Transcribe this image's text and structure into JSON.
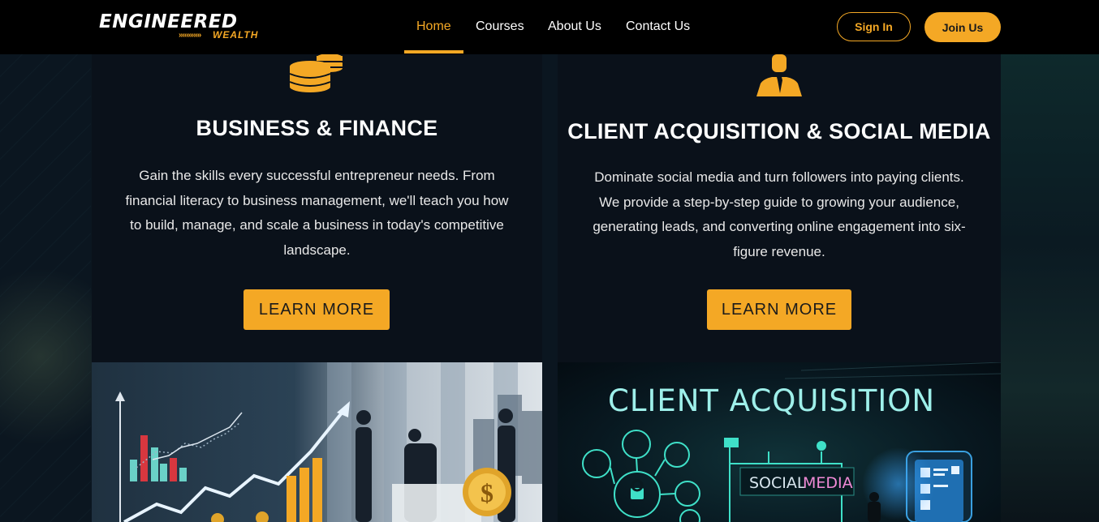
{
  "header": {
    "logo": {
      "main": "ENGINEERED",
      "sub": "WEALTH",
      "arrows": "»»»»»»"
    },
    "nav": [
      {
        "label": "Home",
        "active": true
      },
      {
        "label": "Courses",
        "active": false
      },
      {
        "label": "About Us",
        "active": false
      },
      {
        "label": "Contact Us",
        "active": false
      }
    ],
    "sign_in": "Sign In",
    "join_us": "Join Us"
  },
  "cards": [
    {
      "icon": "coins-stack-icon",
      "title": "BUSINESS & FINANCE",
      "desc_lines": [
        "Gain the skills every successful entrepreneur needs. From",
        "financial literacy to business management, we'll teach you how",
        "to build, manage, and scale a business in today's competitive",
        "landscape."
      ],
      "button": "LEARN MORE"
    },
    {
      "icon": "businessman-icon",
      "title": "CLIENT ACQUISITION & SOCIAL MEDIA",
      "desc_lines": [
        "Dominate social media and turn followers into paying clients.",
        "We provide a step-by-step guide to growing your audience,",
        "generating leads, and converting online engagement into six-",
        "figure revenue."
      ],
      "button": "LEARN MORE"
    }
  ],
  "images": {
    "right_heading": "CLIENT ACQUISITION",
    "right_social": "SOCIAL",
    "right_media": "MEDIA",
    "coin_symbol": "$"
  },
  "colors": {
    "accent": "#f4a825",
    "header_bg": "#000000",
    "card_bg": "#0a111a",
    "page_bg": "#0b1620"
  }
}
